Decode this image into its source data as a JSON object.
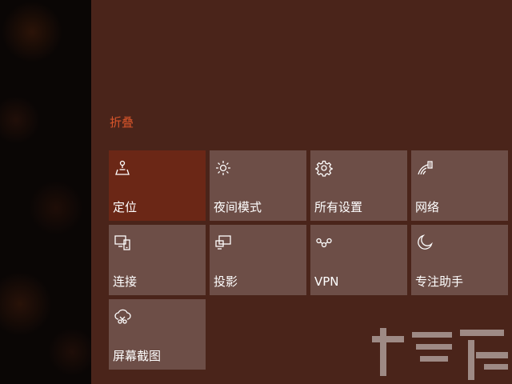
{
  "action_center": {
    "collapse_label": "折叠",
    "accent_color": "#d8552a",
    "panel_color": "#4a241a",
    "tile_color": "#6d4e47",
    "active_tile_color": "#6b2716",
    "tiles": [
      {
        "label": "定位",
        "icon": "location-icon",
        "active": true
      },
      {
        "label": "夜间模式",
        "icon": "brightness-sun-icon",
        "active": false
      },
      {
        "label": "所有设置",
        "icon": "gear-icon",
        "active": false
      },
      {
        "label": "网络",
        "icon": "network-signal-icon",
        "active": false
      },
      {
        "label": "连接",
        "icon": "connect-devices-icon",
        "active": false
      },
      {
        "label": "投影",
        "icon": "project-screen-icon",
        "active": false
      },
      {
        "label": "VPN",
        "icon": "vpn-icon",
        "active": false
      },
      {
        "label": "专注助手",
        "icon": "moon-icon",
        "active": false
      },
      {
        "label": "屏幕截图",
        "icon": "snip-screenshot-icon",
        "active": false
      }
    ]
  }
}
